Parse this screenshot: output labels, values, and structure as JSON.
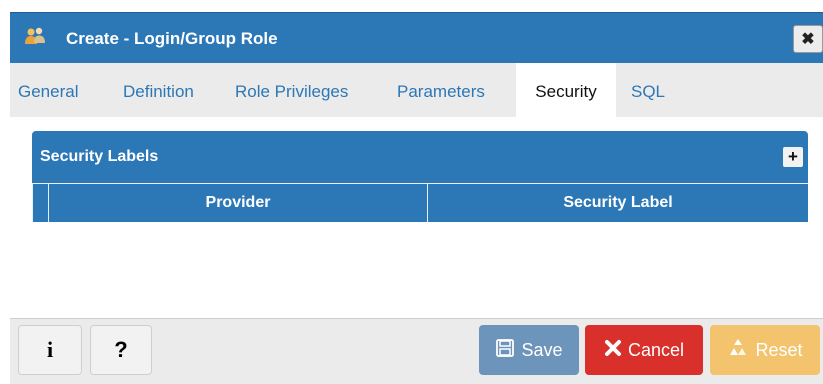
{
  "dialog": {
    "title": "Create - Login/Group Role",
    "close_label": "✖"
  },
  "tabs": [
    {
      "label": "General",
      "active": false
    },
    {
      "label": "Definition",
      "active": false
    },
    {
      "label": "Role Privileges",
      "active": false
    },
    {
      "label": "Parameters",
      "active": false
    },
    {
      "label": "Security",
      "active": true
    },
    {
      "label": "SQL",
      "active": false
    }
  ],
  "security": {
    "panel_title": "Security Labels",
    "add_label": "+",
    "columns": [
      "Provider",
      "Security Label"
    ]
  },
  "footer": {
    "info_label": "i",
    "help_label": "?",
    "save_label": "Save",
    "cancel_label": "Cancel",
    "reset_label": "Reset"
  },
  "colors": {
    "accent": "#2c77b6",
    "cancel": "#d9302b",
    "save": "#6d94ba",
    "reset": "#f3c36d"
  }
}
